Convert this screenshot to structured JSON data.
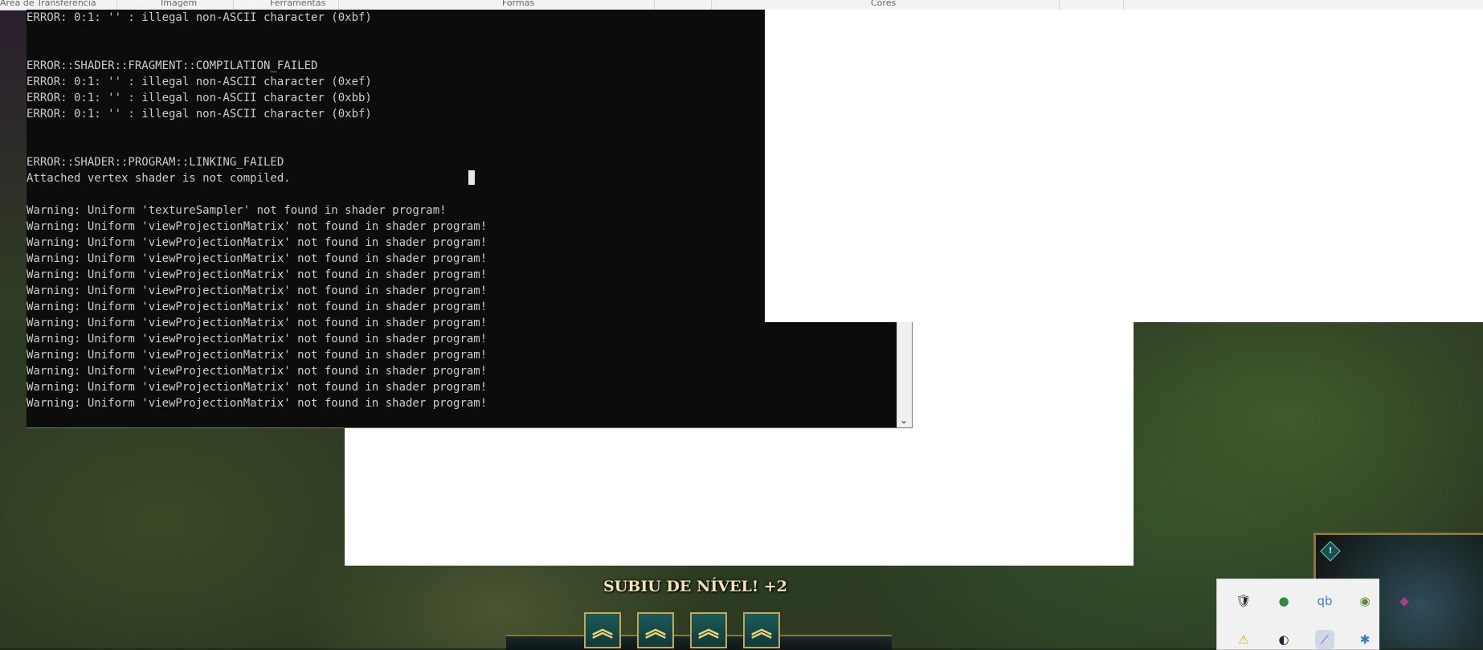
{
  "paint_ribbon": {
    "groups": [
      "Área de Transferência",
      "Imagem",
      "Ferramentas",
      "Formas",
      "Cores"
    ]
  },
  "console": {
    "lines": [
      "ERROR: 0:1: '' : illegal non-ASCII character (0xbf)",
      "",
      "",
      "ERROR::SHADER::FRAGMENT::COMPILATION_FAILED",
      "ERROR: 0:1: '' : illegal non-ASCII character (0xef)",
      "ERROR: 0:1: '' : illegal non-ASCII character (0xbb)",
      "ERROR: 0:1: '' : illegal non-ASCII character (0xbf)",
      "",
      "",
      "ERROR::SHADER::PROGRAM::LINKING_FAILED",
      "Attached vertex shader is not compiled.",
      "",
      "Warning: Uniform 'textureSampler' not found in shader program!",
      "Warning: Uniform 'viewProjectionMatrix' not found in shader program!",
      "Warning: Uniform 'viewProjectionMatrix' not found in shader program!",
      "Warning: Uniform 'viewProjectionMatrix' not found in shader program!",
      "Warning: Uniform 'viewProjectionMatrix' not found in shader program!",
      "Warning: Uniform 'viewProjectionMatrix' not found in shader program!",
      "Warning: Uniform 'viewProjectionMatrix' not found in shader program!",
      "Warning: Uniform 'viewProjectionMatrix' not found in shader program!",
      "Warning: Uniform 'viewProjectionMatrix' not found in shader program!",
      "Warning: Uniform 'viewProjectionMatrix' not found in shader program!",
      "Warning: Uniform 'viewProjectionMatrix' not found in shader program!",
      "Warning: Uniform 'viewProjectionMatrix' not found in shader program!",
      "Warning: Uniform 'viewProjectionMatrix' not found in shader program!"
    ],
    "scroll_down_icon": "chevron-down-icon"
  },
  "game_hud": {
    "level_up_text": "SUBIU DE NÍVEL! +2",
    "level_up_buttons": [
      "up-chevron-icon",
      "up-chevron-icon",
      "up-chevron-icon",
      "up-chevron-icon"
    ],
    "minimap_alert_glyph": "!"
  },
  "system_tray": {
    "icons": [
      {
        "name": "windows-security-icon",
        "glyph": "🛡",
        "color": "#2a2a2a"
      },
      {
        "name": "xbox-icon",
        "glyph": "●",
        "color": "#2e8b3e"
      },
      {
        "name": "qbittorrent-icon",
        "glyph": "qb",
        "color": "#3b7ccf"
      },
      {
        "name": "nvidia-icon",
        "glyph": "◉",
        "color": "#5a8a2a"
      },
      {
        "name": "league-client-icon",
        "glyph": "◆",
        "color": "#b03a8a"
      },
      {
        "name": "warning-icon",
        "glyph": "⚠",
        "color": "#d8b400"
      },
      {
        "name": "steam-icon",
        "glyph": "◐",
        "color": "#1b2838"
      },
      {
        "name": "feather-icon",
        "glyph": "⟋",
        "color": "#8a4bd8"
      },
      {
        "name": "bluetooth-icon",
        "glyph": "✱",
        "color": "#2b7bd8"
      }
    ]
  }
}
